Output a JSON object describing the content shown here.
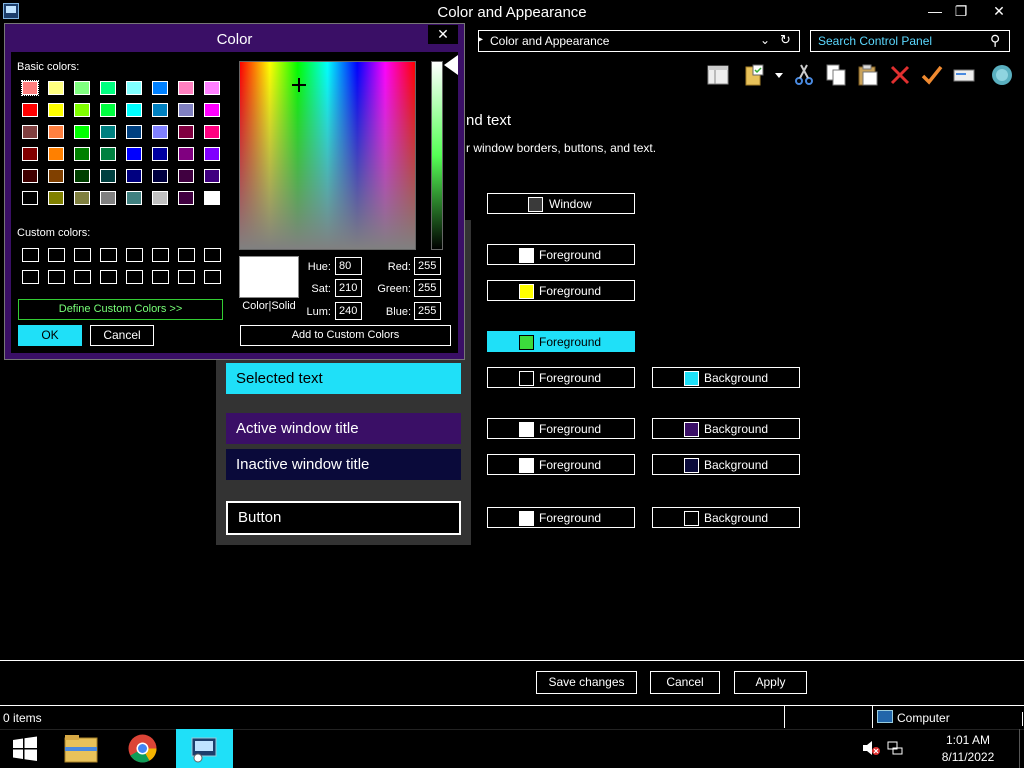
{
  "window": {
    "title": "Color and Appearance",
    "minimize": "—",
    "maximize": "❐",
    "close": "✕"
  },
  "address": {
    "arrow": "▸",
    "path": "Color and Appearance",
    "dropdown": "⌄",
    "refresh": "↻"
  },
  "search": {
    "placeholder": "Search Control Panel",
    "icon": "⚲"
  },
  "content": {
    "heading_fragment": "nd text",
    "desc_fragment": "r window borders, buttons, and text."
  },
  "items": [
    {
      "label": "Window",
      "swatch": "#3a3a3a"
    },
    {
      "label": "Foreground",
      "swatch": "#ffffff"
    },
    {
      "label": "Foreground",
      "swatch": "#ffff00"
    },
    {
      "label": "Foreground",
      "swatch": "#3cdc3c"
    },
    {
      "label": "Foreground",
      "swatch": "#000000"
    },
    {
      "label": "Background",
      "swatch": "#1fe0f8"
    },
    {
      "label": "Foreground",
      "swatch": "#ffffff"
    },
    {
      "label": "Background",
      "swatch": "#3a0f66"
    },
    {
      "label": "Foreground",
      "swatch": "#ffffff"
    },
    {
      "label": "Background",
      "swatch": "#0a0a3a"
    },
    {
      "label": "Foreground",
      "swatch": "#ffffff"
    },
    {
      "label": "Background",
      "swatch": "#000000"
    }
  ],
  "preview": {
    "selected_text": "Selected text",
    "active_title": "Active window title",
    "inactive_title": "Inactive window title",
    "button": "Button"
  },
  "footer": {
    "save": "Save changes",
    "cancel": "Cancel",
    "apply": "Apply"
  },
  "status": {
    "items": "0 items",
    "computer": "Computer"
  },
  "taskbar": {
    "time": "1:01 AM",
    "date": "8/11/2022"
  },
  "dialog": {
    "title": "Color",
    "close": "✕",
    "basic_label": "Basic colors:",
    "custom_label": "Custom colors:",
    "define_custom": "Define Custom Colors >>",
    "ok": "OK",
    "cancel": "Cancel",
    "color_solid": "Color|Solid",
    "add_custom": "Add to Custom Colors",
    "hue_label": "Hue:",
    "hue": "80",
    "sat_label": "Sat:",
    "sat": "210",
    "lum_label": "Lum:",
    "lum": "240",
    "red_label": "Red:",
    "red": "255",
    "green_label": "Green:",
    "green": "255",
    "blue_label": "Blue:",
    "blue": "255",
    "basic_colors": [
      "#ff8080",
      "#ffff80",
      "#80ff80",
      "#00ff80",
      "#80ffff",
      "#0080ff",
      "#ff80c0",
      "#ff80ff",
      "#ff0000",
      "#ffff00",
      "#80ff00",
      "#00ff40",
      "#00ffff",
      "#0080c0",
      "#8080c0",
      "#ff00ff",
      "#804040",
      "#ff8040",
      "#00ff00",
      "#008080",
      "#004080",
      "#8080ff",
      "#800040",
      "#ff0080",
      "#800000",
      "#ff8000",
      "#008000",
      "#008040",
      "#0000ff",
      "#0000a0",
      "#800080",
      "#8000ff",
      "#400000",
      "#804000",
      "#004000",
      "#004040",
      "#000080",
      "#000040",
      "#400040",
      "#400080",
      "#000000",
      "#808000",
      "#808040",
      "#808080",
      "#408080",
      "#c0c0c0",
      "#400040",
      "#ffffff"
    ]
  }
}
